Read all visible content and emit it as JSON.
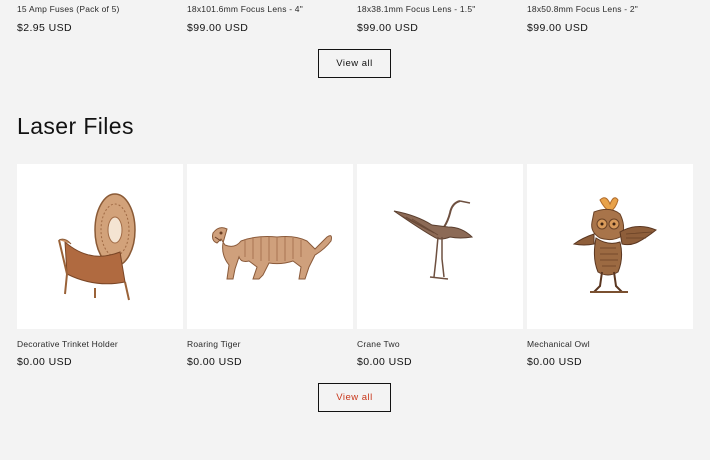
{
  "featured_products": [
    {
      "title": "15 Amp Fuses (Pack of 5)",
      "price": "$2.95 USD"
    },
    {
      "title": "18x101.6mm Focus Lens - 4\"",
      "price": "$99.00 USD"
    },
    {
      "title": "18x38.1mm Focus Lens - 1.5\"",
      "price": "$99.00 USD"
    },
    {
      "title": "18x50.8mm Focus Lens - 2\"",
      "price": "$99.00 USD"
    }
  ],
  "featured_view_all": "View all",
  "laser_files": {
    "heading": "Laser Files",
    "items": [
      {
        "title": "Decorative Trinket Holder",
        "price": "$0.00 USD",
        "image": "trinket-holder-image"
      },
      {
        "title": "Roaring Tiger",
        "price": "$0.00 USD",
        "image": "tiger-image"
      },
      {
        "title": "Crane Two",
        "price": "$0.00 USD",
        "image": "crane-image"
      },
      {
        "title": "Mechanical Owl",
        "price": "$0.00 USD",
        "image": "owl-image"
      }
    ],
    "view_all": "View all"
  },
  "colors": {
    "background": "#f3f3f3",
    "card_background": "#ffffff",
    "accent_button_text": "#c8361a",
    "wood": "#c9956b"
  }
}
